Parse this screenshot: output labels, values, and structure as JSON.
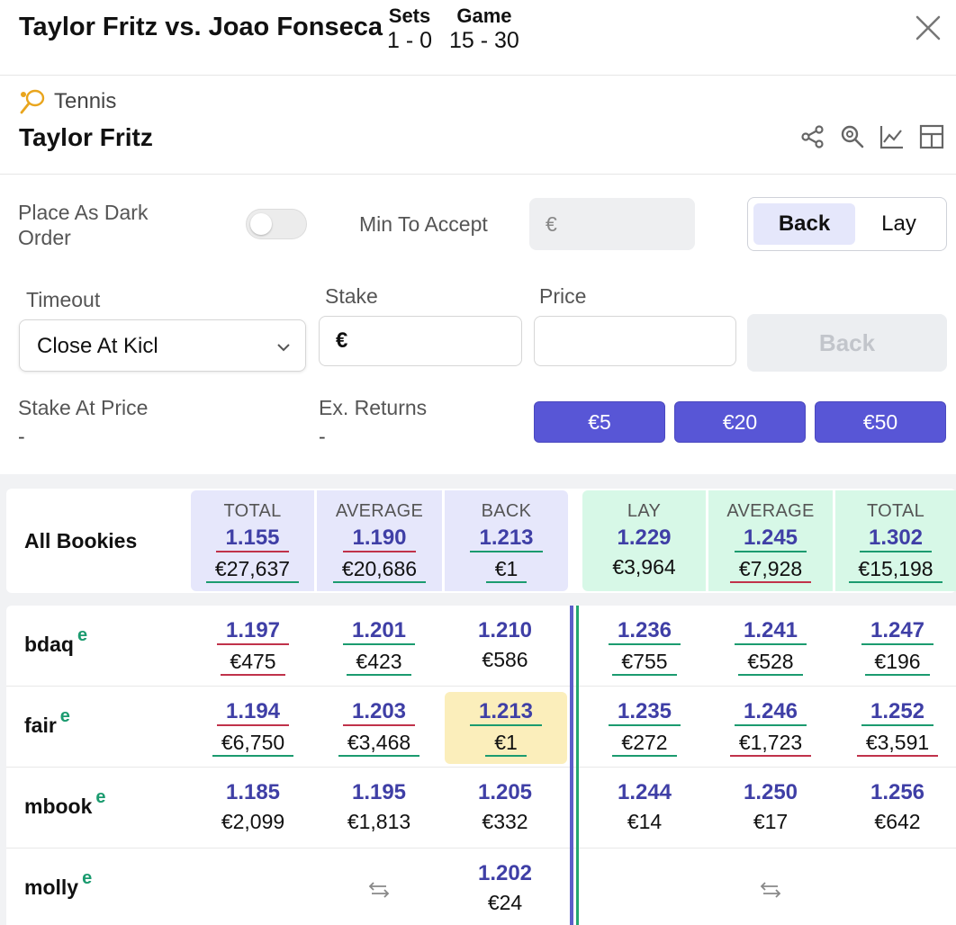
{
  "header": {
    "match_title": "Taylor Fritz vs. Joao Fonseca",
    "sets_label": "Sets",
    "sets_value": "1 - 0",
    "game_label": "Game",
    "game_value": "15 - 30",
    "close_icon": "close-icon"
  },
  "market": {
    "sport_icon": "tennis-racket-icon",
    "sport": "Tennis",
    "runner": "Taylor Fritz",
    "tools": [
      "share-icon",
      "search-zoom-icon",
      "chart-icon",
      "grid-icon"
    ]
  },
  "form": {
    "dark_order_label": "Place As Dark Order",
    "dark_order_on": false,
    "min_accept_label": "Min To Accept",
    "min_accept_placeholder": "€",
    "side_back": "Back",
    "side_lay": "Lay",
    "selected_side": "Back",
    "timeout_label": "Timeout",
    "timeout_value": "Close At Kicl",
    "stake_label": "Stake",
    "stake_value": "€",
    "price_label": "Price",
    "price_value": "",
    "place_button": "Back",
    "stake_at_price_label": "Stake At Price",
    "stake_at_price_value": "-",
    "ex_returns_label": "Ex. Returns",
    "ex_returns_value": "-",
    "quick_stakes": [
      "€5",
      "€20",
      "€50"
    ]
  },
  "ladder": {
    "all_label": "All Bookies",
    "summary": [
      {
        "head": "TOTAL",
        "price": "1.155",
        "stake": "€27,637"
      },
      {
        "head": "AVERAGE",
        "price": "1.190",
        "stake": "€20,686"
      },
      {
        "head": "BACK",
        "price": "1.213",
        "stake": "€1"
      },
      {
        "head": "LAY",
        "price": "1.229",
        "stake": "€3,964"
      },
      {
        "head": "AVERAGE",
        "price": "1.245",
        "stake": "€7,928"
      },
      {
        "head": "TOTAL",
        "price": "1.302",
        "stake": "€15,198"
      }
    ],
    "bookies": [
      {
        "name": "bdaq",
        "badge": "e",
        "cells": [
          {
            "price": "1.197",
            "stake": "€475"
          },
          {
            "price": "1.201",
            "stake": "€423"
          },
          {
            "price": "1.210",
            "stake": "€586"
          },
          {
            "price": "1.236",
            "stake": "€755"
          },
          {
            "price": "1.241",
            "stake": "€528"
          },
          {
            "price": "1.247",
            "stake": "€196"
          }
        ]
      },
      {
        "name": "fair",
        "badge": "e",
        "cells": [
          {
            "price": "1.194",
            "stake": "€6,750"
          },
          {
            "price": "1.203",
            "stake": "€3,468"
          },
          {
            "price": "1.213",
            "stake": "€1"
          },
          {
            "price": "1.235",
            "stake": "€272"
          },
          {
            "price": "1.246",
            "stake": "€1,723"
          },
          {
            "price": "1.252",
            "stake": "€3,591"
          }
        ]
      },
      {
        "name": "mbook",
        "badge": "e",
        "cells": [
          {
            "price": "1.185",
            "stake": "€2,099"
          },
          {
            "price": "1.195",
            "stake": "€1,813"
          },
          {
            "price": "1.205",
            "stake": "€332"
          },
          {
            "price": "1.244",
            "stake": "€14"
          },
          {
            "price": "1.250",
            "stake": "€17"
          },
          {
            "price": "1.256",
            "stake": "€642"
          }
        ]
      },
      {
        "name": "molly",
        "badge": "e",
        "cells": [
          {
            "price": "1.202",
            "stake": "€24"
          }
        ]
      }
    ]
  },
  "colors": {
    "accent": "#5856d6",
    "price": "#3f3fa6",
    "back_bg": "#e6e7fb",
    "lay_bg": "#d7f8e7",
    "highlight": "#fbeebb",
    "red_line": "#c0324a",
    "green_line": "#1b9b6f"
  }
}
